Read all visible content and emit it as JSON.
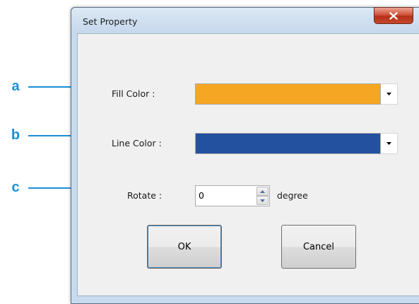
{
  "colors": {
    "callout": "#1a8fd6",
    "fill_color": "#f5a623",
    "line_color": "#2450a0"
  },
  "callouts": [
    {
      "letter": "a"
    },
    {
      "letter": "b"
    },
    {
      "letter": "c"
    }
  ],
  "dialog": {
    "title": "Set Property",
    "close_icon": "close-x-icon",
    "fill_color_label": "Fill Color :",
    "line_color_label": "Line Color :",
    "rotate_label": "Rotate :",
    "rotate_value": "0",
    "rotate_unit": "degree",
    "ok_label": "OK",
    "cancel_label": "Cancel"
  }
}
